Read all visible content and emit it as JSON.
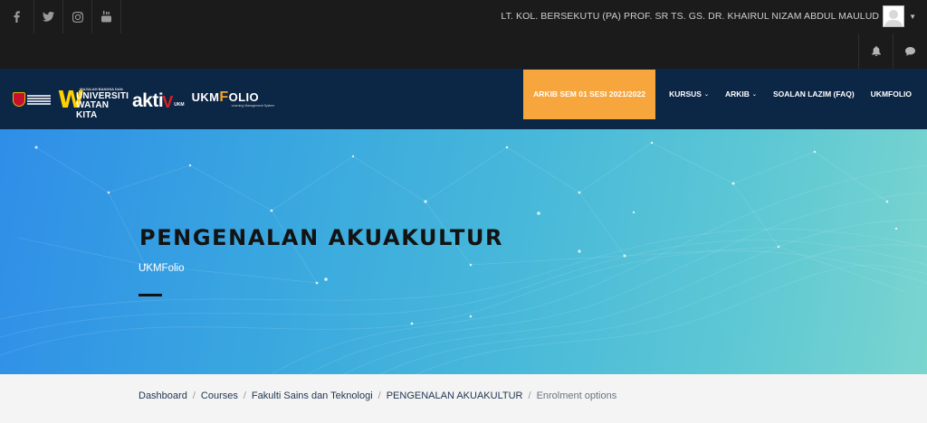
{
  "social": {
    "icons": [
      "facebook-icon",
      "twitter-icon",
      "instagram-icon",
      "youtube-icon"
    ]
  },
  "user": {
    "name": "LT. KOL. BERSEKUTU (PA) PROF. SR TS. GS. DR. KHAIRUL NIZAM ABDUL MAULUD"
  },
  "toolbar_icons": [
    "bell-icon",
    "chat-icon"
  ],
  "logos": {
    "uwk_tag": "MAJULAH BANGSA DAN",
    "uwk_line1": "UNIVERSITI",
    "uwk_line2": "WATAN KITA",
    "aktiv": "akti",
    "aktiv_v": "V",
    "aktiv_ukm": "UKM",
    "ukmfolio_a": "UKM",
    "ukmfolio_f": "F",
    "ukmfolio_b": "OLIO",
    "ukmfolio_sub": "Learning Management System"
  },
  "nav": {
    "highlight": "ARKIB SEM 01 SESI 2021/2022",
    "items": [
      {
        "label": "KURSUS",
        "dropdown": true
      },
      {
        "label": "ARKIB",
        "dropdown": true
      },
      {
        "label": "SOALAN LAZIM (FAQ)",
        "dropdown": false
      },
      {
        "label": "UKMFOLIO",
        "dropdown": false
      }
    ]
  },
  "hero": {
    "title": "PENGENALAN AKUAKULTUR",
    "subtitle": "UKMFolio"
  },
  "breadcrumb": {
    "items": [
      "Dashboard",
      "Courses",
      "Fakulti Sains dan Teknologi",
      "PENGENALAN AKUAKULTUR"
    ],
    "current": "Enrolment options",
    "separator": "/"
  },
  "colors": {
    "topbar": "#1b1b1b",
    "navbar": "#0c2646",
    "highlight": "#f7a63d",
    "hero_start": "#2f8ee8",
    "hero_end": "#7ad5cf"
  }
}
